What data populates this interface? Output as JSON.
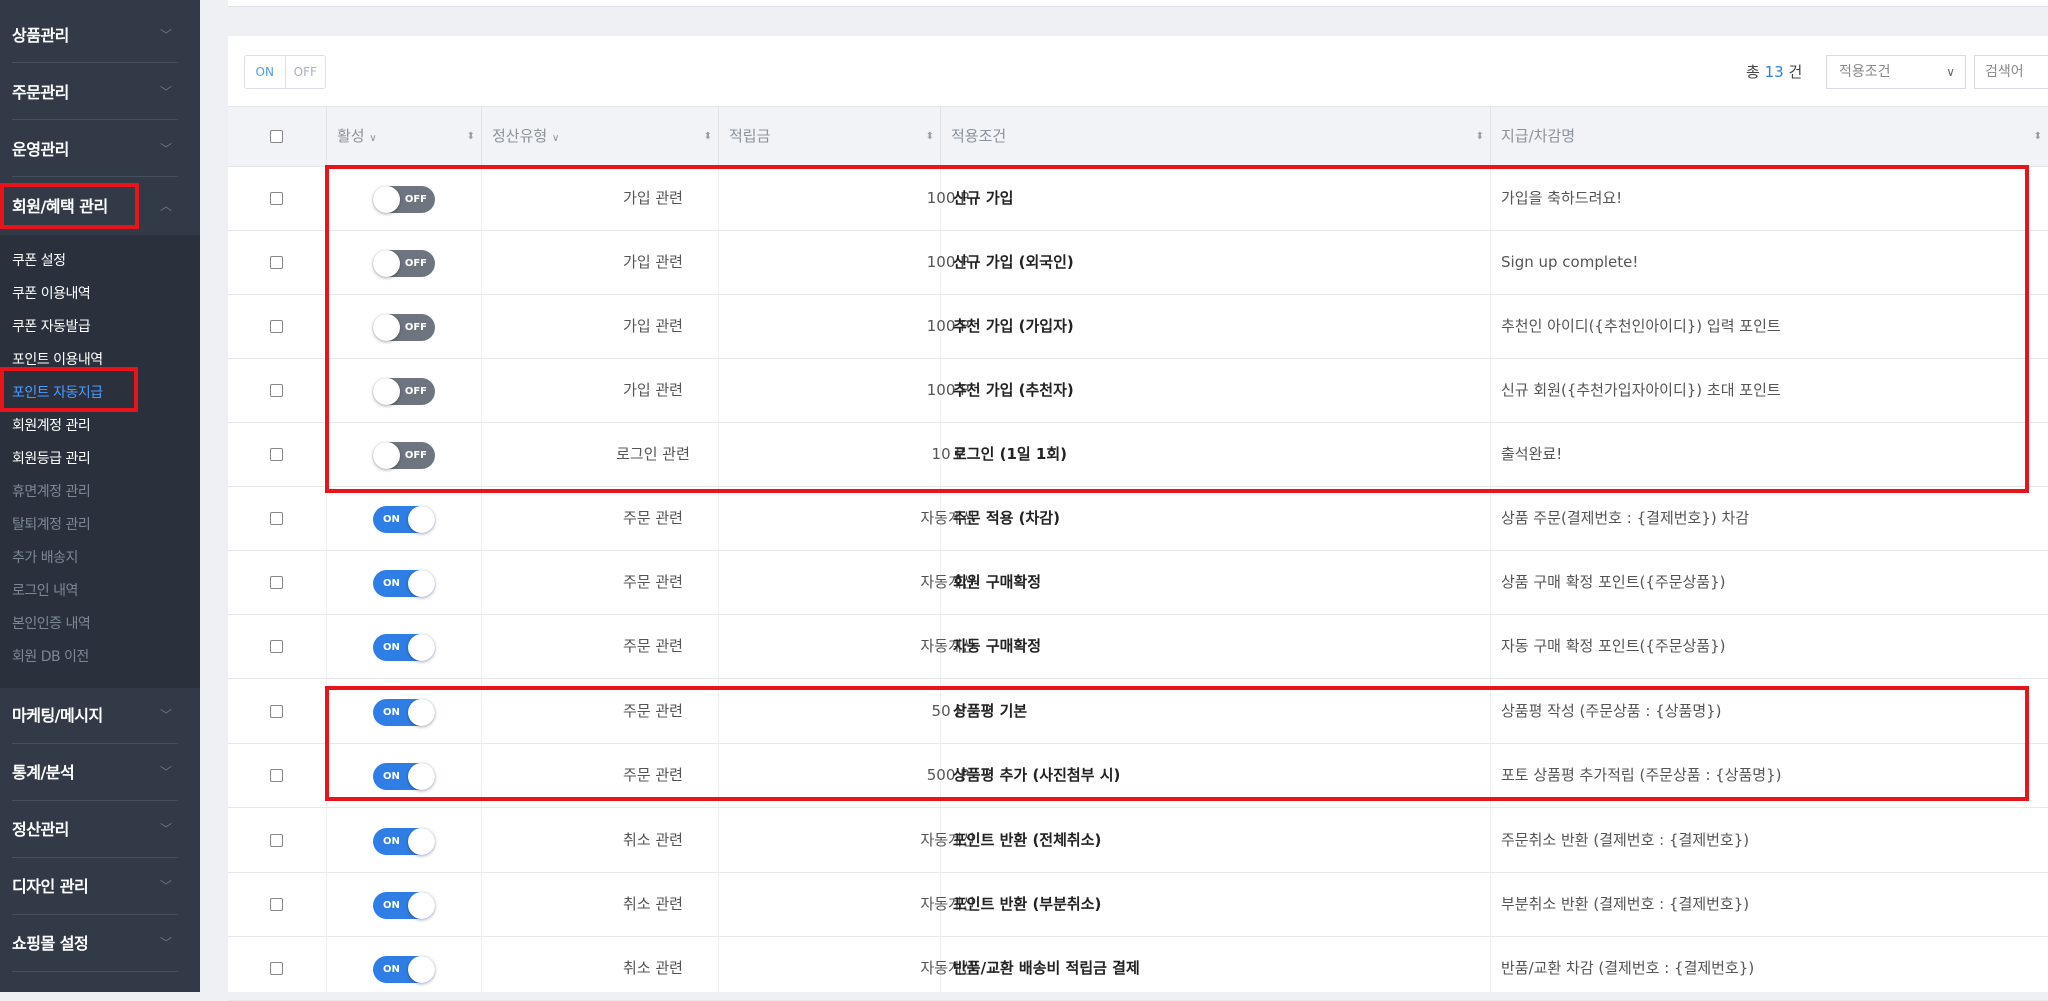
{
  "sidebar": {
    "menus_top": [
      {
        "label": "상품관리"
      },
      {
        "label": "주문관리"
      },
      {
        "label": "운영관리"
      },
      {
        "label": "회원/혜택 관리"
      }
    ],
    "submenu": [
      {
        "label": "쿠폰 설정"
      },
      {
        "label": "쿠폰 이용내역"
      },
      {
        "label": "쿠폰 자동발급"
      },
      {
        "label": "포인트 이용내역"
      },
      {
        "label": "포인트 자동지급"
      },
      {
        "label": "회원계정 관리"
      },
      {
        "label": "회원등급 관리"
      },
      {
        "label": "휴면계정 관리"
      },
      {
        "label": "탈퇴계정 관리"
      },
      {
        "label": "추가 배송지"
      },
      {
        "label": "로그인 내역"
      },
      {
        "label": "본인인증 내역"
      },
      {
        "label": "회원 DB 이전"
      }
    ],
    "menus_bottom": [
      {
        "label": "마케팅/메시지"
      },
      {
        "label": "통계/분석"
      },
      {
        "label": "정산관리"
      },
      {
        "label": "디자인 관리"
      },
      {
        "label": "쇼핑몰 설정"
      }
    ]
  },
  "toolbar": {
    "on_label": "ON",
    "off_label": "OFF",
    "total_prefix": "총",
    "total_count": "13",
    "total_suffix": "건",
    "filter_select": "적용조건",
    "search_placeholder": "검색어"
  },
  "table": {
    "headers": [
      "활성",
      "정산유형",
      "적립금",
      "적용조건",
      "지급/차감명"
    ],
    "rows": [
      {
        "active": false,
        "toggle_text": "OFF",
        "type": "가입 관련",
        "point": "100 P",
        "condition": "신규 가입",
        "message": "가입을 축하드려요!"
      },
      {
        "active": false,
        "toggle_text": "OFF",
        "type": "가입 관련",
        "point": "100 P",
        "condition": "신규 가입 (외국인)",
        "message": "Sign up complete!"
      },
      {
        "active": false,
        "toggle_text": "OFF",
        "type": "가입 관련",
        "point": "100 P",
        "condition": "추천 가입 (가입자)",
        "message": "추천인 아이디({추천인아이디}) 입력 포인트"
      },
      {
        "active": false,
        "toggle_text": "OFF",
        "type": "가입 관련",
        "point": "100 P",
        "condition": "추천 가입 (추천자)",
        "message": "신규 회원({추천가입자아이디}) 초대 포인트"
      },
      {
        "active": false,
        "toggle_text": "OFF",
        "type": "로그인 관련",
        "point": "10 P",
        "condition": "로그인 (1일 1회)",
        "message": "출석완료!"
      },
      {
        "active": true,
        "toggle_text": "ON",
        "type": "주문 관련",
        "point": "자동계산",
        "condition": "주문 적용 (차감)",
        "message": "상품 주문(결제번호 : {결제번호}) 차감"
      },
      {
        "active": true,
        "toggle_text": "ON",
        "type": "주문 관련",
        "point": "자동계산",
        "condition": "회원 구매확정",
        "message": "상품 구매 확정 포인트({주문상품})"
      },
      {
        "active": true,
        "toggle_text": "ON",
        "type": "주문 관련",
        "point": "자동계산",
        "condition": "자동 구매확정",
        "message": "자동 구매 확정 포인트({주문상품})"
      },
      {
        "active": true,
        "toggle_text": "ON",
        "type": "주문 관련",
        "point": "50 P",
        "condition": "상품평 기본",
        "message": "상품평 작성 (주문상품 : {상품명})"
      },
      {
        "active": true,
        "toggle_text": "ON",
        "type": "주문 관련",
        "point": "500 P",
        "condition": "상품평 추가 (사진첨부 시)",
        "message": "포토 상품평 추가적립 (주문상품 : {상품명})"
      },
      {
        "active": true,
        "toggle_text": "ON",
        "type": "취소 관련",
        "point": "자동계산",
        "condition": "포인트 반환 (전체취소)",
        "message": "주문취소 반환 (결제번호 : {결제번호})"
      },
      {
        "active": true,
        "toggle_text": "ON",
        "type": "취소 관련",
        "point": "자동계산",
        "condition": "포인트 반환 (부분취소)",
        "message": "부분취소 반환 (결제번호 : {결제번호})"
      },
      {
        "active": true,
        "toggle_text": "ON",
        "type": "취소 관련",
        "point": "자동계산",
        "condition": "반품/교환 배송비 적립금 결제",
        "message": "반품/교환 차감 (결제번호 : {결제번호})"
      }
    ]
  },
  "colors": {
    "sidebar_bg": "#323a47",
    "submenu_bg": "#2a313c",
    "active_link": "#4c9aff",
    "toggle_on": "#2f7ee6",
    "toggle_off": "#6e7480",
    "highlight_box": "#e8141a"
  }
}
